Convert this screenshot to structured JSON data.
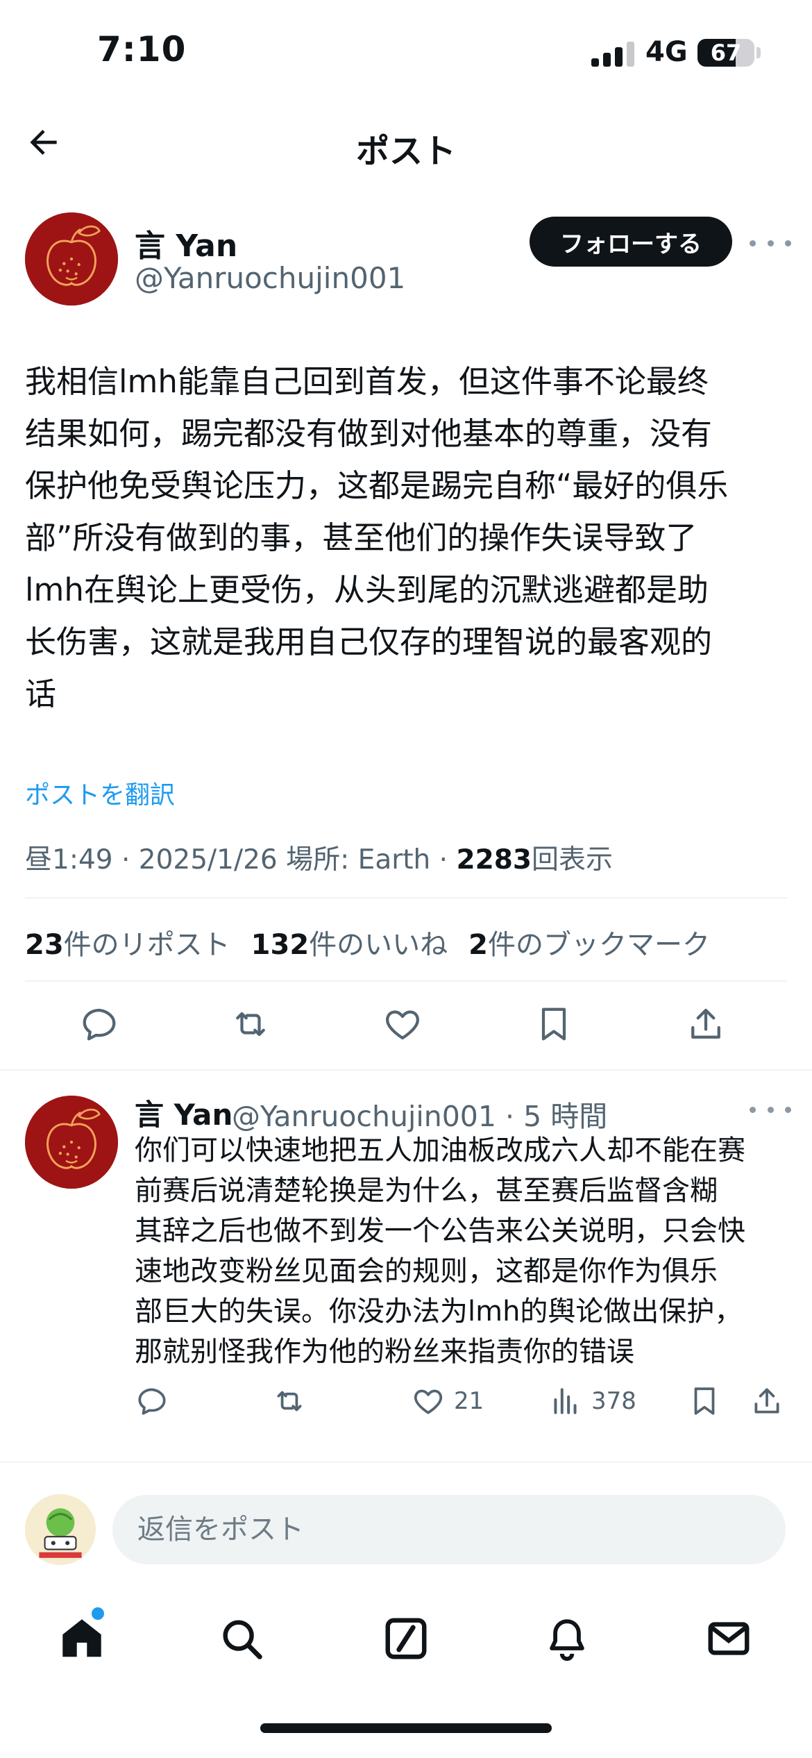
{
  "status_bar": {
    "time": "7:10",
    "network": "4G",
    "battery": "67",
    "battery_level": 0.67
  },
  "header": {
    "title": "ポスト",
    "back_icon": "arrow-left-icon"
  },
  "post": {
    "author_name": "言 Yan",
    "author_handle": "@Yanruochujin001",
    "follow_label": "フォローする",
    "text": "我相信lmh能靠自己回到首发，但这件事不论最终\n结果如何，踢完都没有做到对他基本的尊重，没有\n保护他免受舆论压力，这都是踢完自称“最好的俱乐\n部”所没有做到的事，甚至他们的操作失误导致了\nlmh在舆论上更受伤，从头到尾的沉默逃避都是助\n长伤害，这就是我用自己仅存的理智说的最客观的\n话",
    "translate_label": "ポストを翻訳",
    "meta_prefix": "昼1:49 · 2025/1/26 場所: Earth · ",
    "views_count": "2283",
    "views_suffix": "回表示",
    "stats": {
      "reposts_count": "23",
      "reposts_label": "件のリポスト",
      "likes_count": "132",
      "likes_label": "件のいいね",
      "bookmarks_count": "2",
      "bookmarks_label": "件のブックマーク"
    },
    "actions": [
      "reply-icon",
      "repost-icon",
      "like-icon",
      "bookmark-icon",
      "share-icon"
    ]
  },
  "reply": {
    "author_name": "言 Yan",
    "author_handle": "@Yanruochujin001 · 5 時間",
    "text": "你们可以快速地把五人加油板改成六人却不能在赛\n前赛后说清楚轮换是为什么，甚至赛后监督含糊\n其辞之后也做不到发一个公告来公关说明，只会快\n速地改变粉丝见面会的规则，这都是你作为俱乐\n部巨大的失误。你没办法为lmh的舆论做出保护，\n那就别怪我作为他的粉丝来指责你的错误",
    "likes": "21",
    "views": "378"
  },
  "composer": {
    "placeholder": "返信をポスト"
  },
  "bottom_nav": [
    "home-icon",
    "search-icon",
    "grok-icon",
    "notifications-icon",
    "messages-icon"
  ],
  "colors": {
    "accent": "#1d9bf0",
    "text_primary": "#0f1419",
    "text_secondary": "#536471",
    "avatar_bg": "#9e1414"
  }
}
